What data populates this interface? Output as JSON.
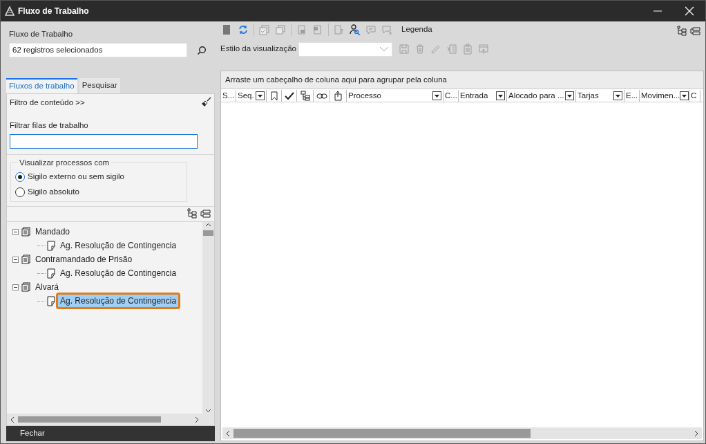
{
  "window": {
    "title": "Fluxo de Trabalho"
  },
  "workflow_field": {
    "label": "Fluxo de Trabalho",
    "value": "62 registros selecionados"
  },
  "toolbar": {
    "buttons": [
      {
        "disabled": false
      },
      {
        "disabled": false
      },
      {
        "disabled": true
      },
      {
        "disabled": true
      },
      {
        "disabled": true
      },
      {
        "disabled": true
      },
      {
        "disabled": true
      },
      {
        "disabled": false
      },
      {
        "disabled": true
      },
      {
        "disabled": true
      }
    ],
    "legend": "Legenda"
  },
  "view_style": {
    "label": "Estilo da visualização",
    "buttons": [
      {
        "disabled": true
      },
      {
        "disabled": true
      },
      {
        "disabled": true
      },
      {
        "disabled": true
      },
      {
        "disabled": true
      },
      {
        "disabled": true
      }
    ]
  },
  "tabs": [
    {
      "label": "Fluxos de trabalho",
      "selected": true
    },
    {
      "label": "Pesquisar",
      "selected": false
    }
  ],
  "content_filter": {
    "title": "Filtro de conteúdo >>",
    "field_label": "Filtrar filas de trabalho"
  },
  "visibility_group": {
    "title": "Visualizar processos com",
    "options": [
      {
        "label": "Sigilo externo ou sem sigilo",
        "selected": true
      },
      {
        "label": "Sigilo absoluto",
        "selected": false
      }
    ]
  },
  "tree": [
    {
      "label": "Mandado",
      "expanded": true,
      "selected": false,
      "children": [
        {
          "label": "Ag. Resolução de Contingencia",
          "selected": false
        }
      ]
    },
    {
      "label": "Contramandado de Prisão",
      "expanded": true,
      "selected": false,
      "children": [
        {
          "label": "Ag. Resolução de Contingencia",
          "selected": false
        }
      ]
    },
    {
      "label": "Alvará",
      "expanded": true,
      "selected": false,
      "children": [
        {
          "label": "Ag. Resolução de Contingencia",
          "selected": true
        }
      ]
    }
  ],
  "close_button": {
    "label": "Fechar"
  },
  "grid": {
    "group_hint": "Arraste um cabeçalho de coluna aqui para agrupar pela coluna",
    "columns": [
      {
        "kind": "text",
        "label": "S...",
        "filter": false
      },
      {
        "kind": "text",
        "label": "Seq.",
        "filter": true
      },
      {
        "kind": "icon",
        "filter": false
      },
      {
        "kind": "icon",
        "filter": false
      },
      {
        "kind": "icon",
        "filter": false
      },
      {
        "kind": "icon",
        "filter": false
      },
      {
        "kind": "icon",
        "filter": false
      },
      {
        "kind": "text",
        "label": "Processo",
        "filter": true
      },
      {
        "kind": "text",
        "label": "C...",
        "filter": false
      },
      {
        "kind": "text",
        "label": "Entrada",
        "filter": true
      },
      {
        "kind": "text",
        "label": "Alocado para ...",
        "filter": true
      },
      {
        "kind": "text",
        "label": "Tarjas",
        "filter": true
      },
      {
        "kind": "text",
        "label": "E...",
        "filter": false
      },
      {
        "kind": "text",
        "label": "Movimen...",
        "filter": true
      },
      {
        "kind": "text",
        "label": "C",
        "filter": false
      }
    ]
  }
}
